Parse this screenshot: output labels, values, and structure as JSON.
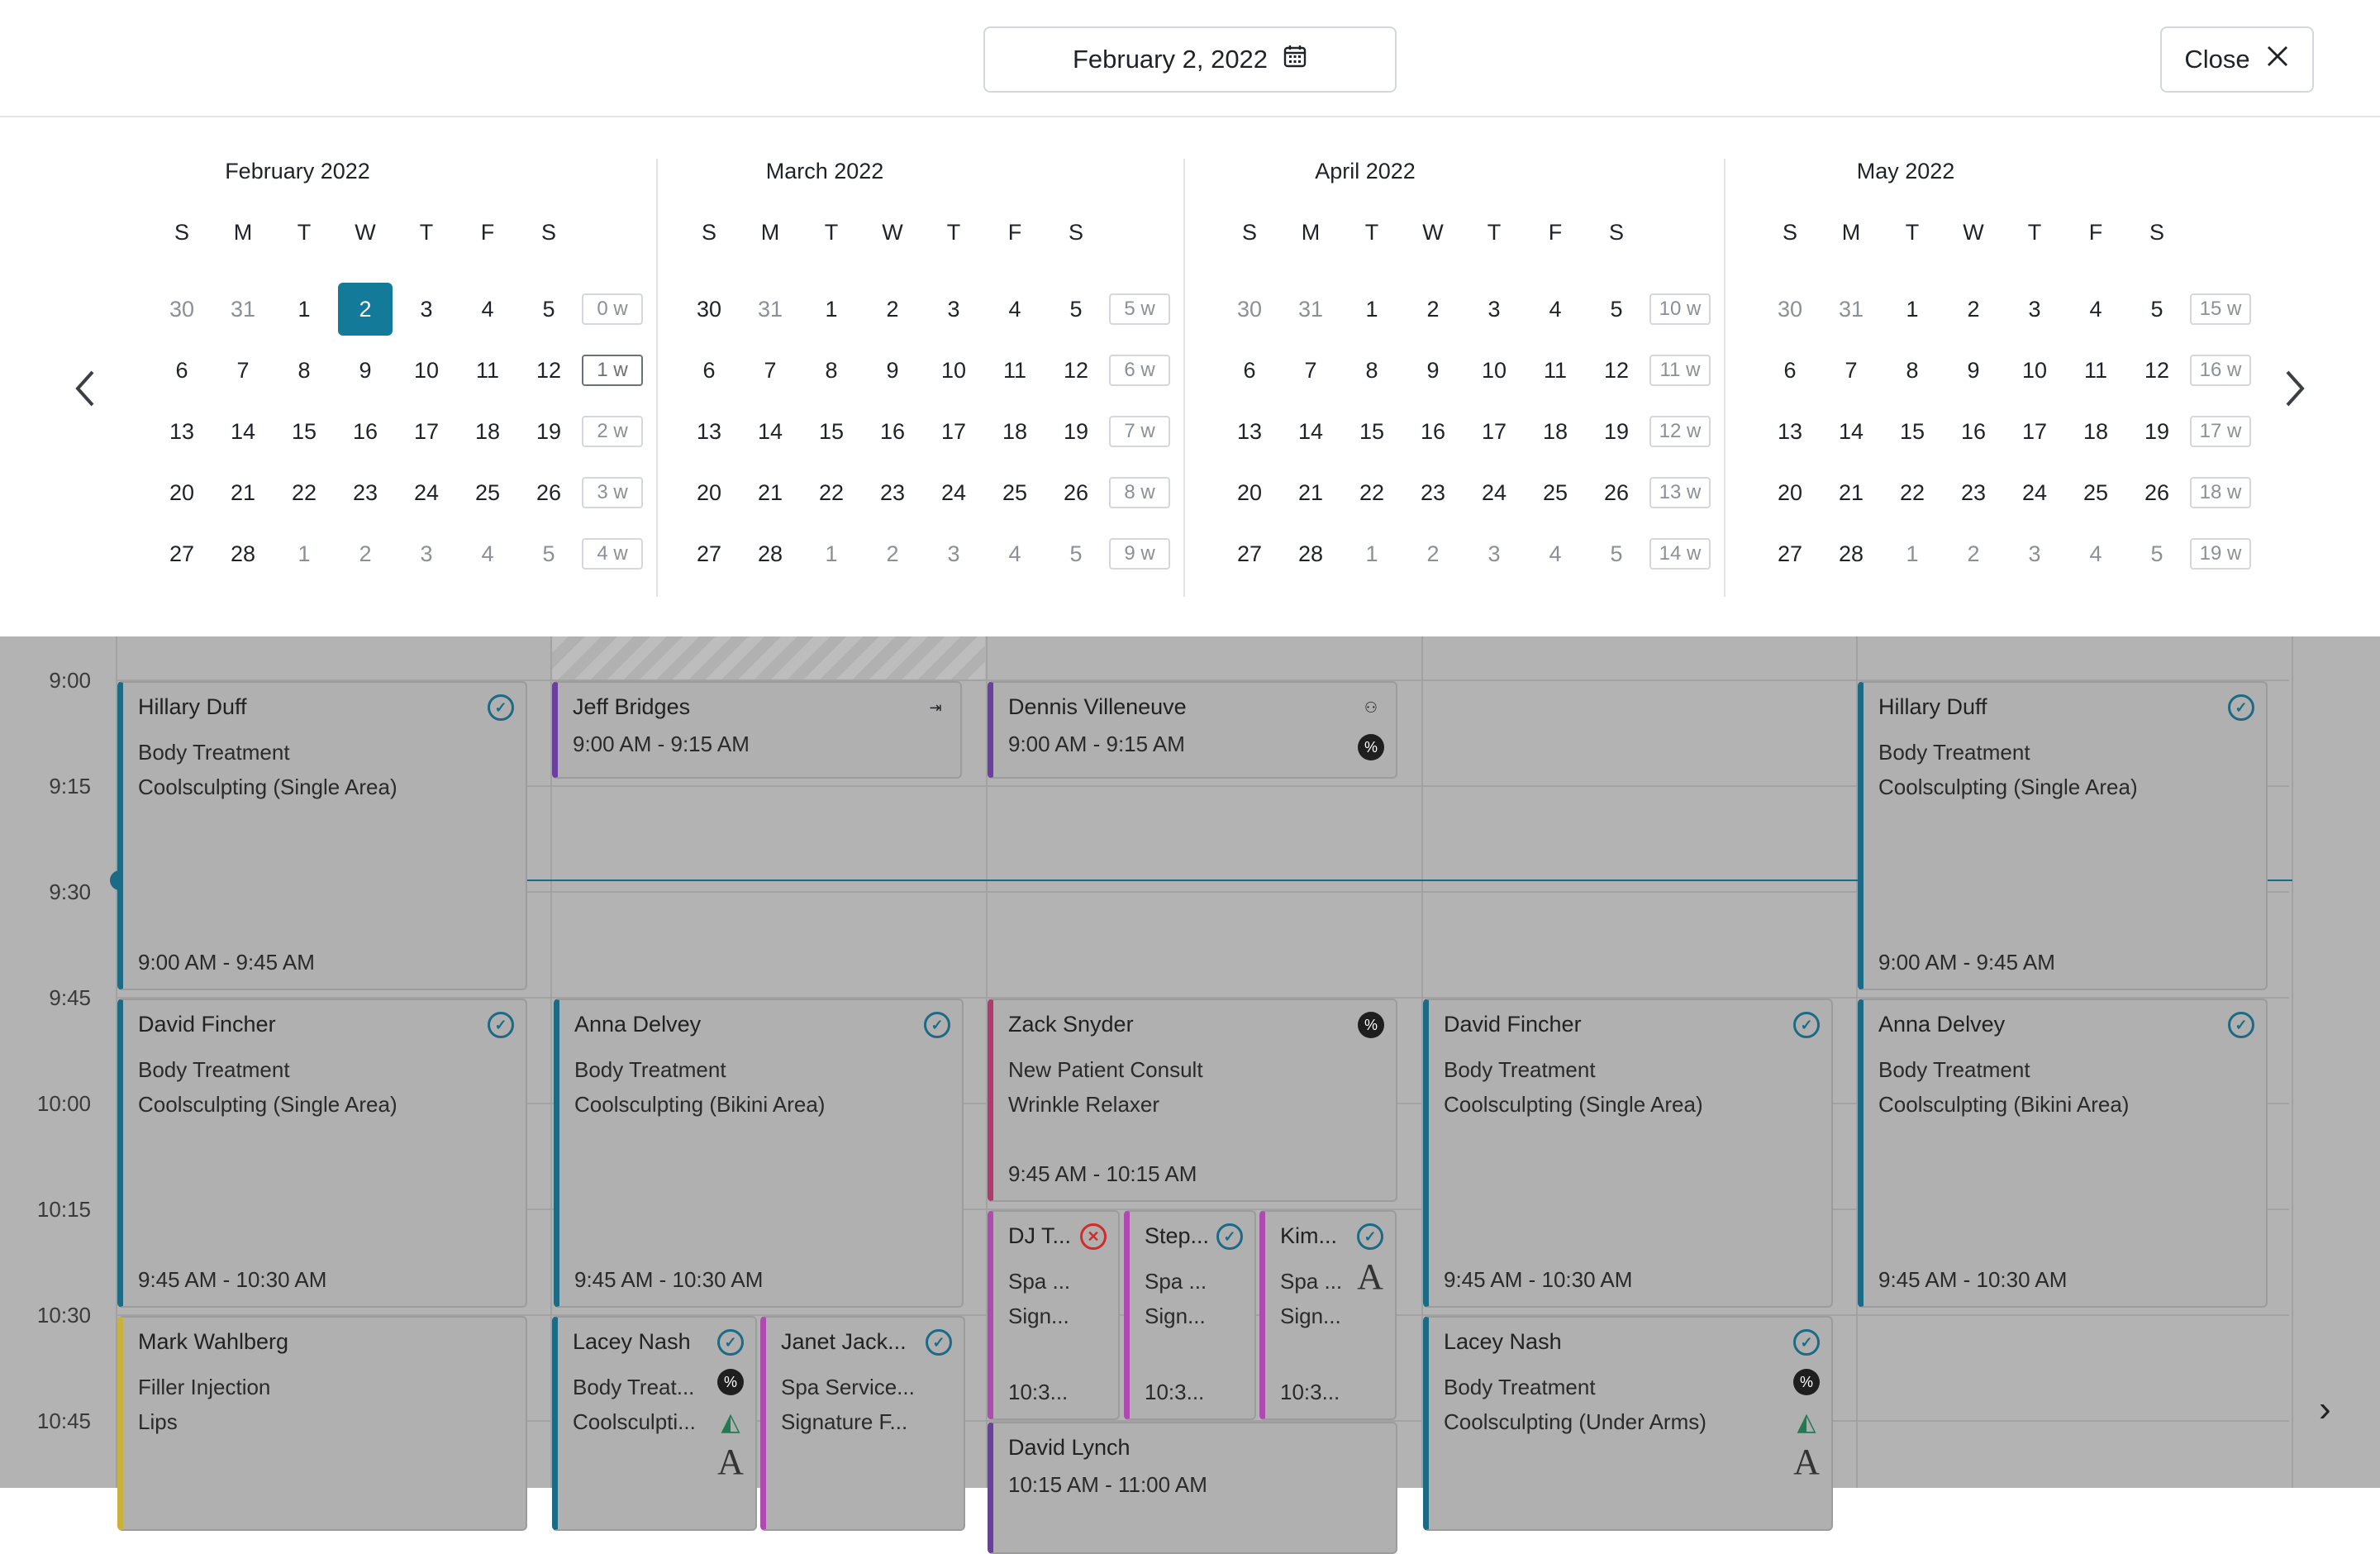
{
  "header": {
    "date_label": "February 2, 2022",
    "close_label": "Close"
  },
  "calendar": {
    "weekday_headers": [
      "S",
      "M",
      "T",
      "W",
      "T",
      "F",
      "S"
    ],
    "selected_day": "2",
    "current_week_label": "1 w",
    "months": [
      {
        "title": "February 2022",
        "weeks": [
          {
            "label": "0 w",
            "days": [
              [
                "30",
                1
              ],
              [
                "31",
                1
              ],
              [
                "1",
                0
              ],
              [
                "2",
                0
              ],
              [
                "3",
                0
              ],
              [
                "4",
                0
              ],
              [
                "5",
                0
              ]
            ]
          },
          {
            "label": "1 w",
            "days": [
              [
                "6",
                0
              ],
              [
                "7",
                0
              ],
              [
                "8",
                0
              ],
              [
                "9",
                0
              ],
              [
                "10",
                0
              ],
              [
                "11",
                0
              ],
              [
                "12",
                0
              ]
            ]
          },
          {
            "label": "2 w",
            "days": [
              [
                "13",
                0
              ],
              [
                "14",
                0
              ],
              [
                "15",
                0
              ],
              [
                "16",
                0
              ],
              [
                "17",
                0
              ],
              [
                "18",
                0
              ],
              [
                "19",
                0
              ]
            ]
          },
          {
            "label": "3 w",
            "days": [
              [
                "20",
                0
              ],
              [
                "21",
                0
              ],
              [
                "22",
                0
              ],
              [
                "23",
                0
              ],
              [
                "24",
                0
              ],
              [
                "25",
                0
              ],
              [
                "26",
                0
              ]
            ]
          },
          {
            "label": "4 w",
            "days": [
              [
                "27",
                0
              ],
              [
                "28",
                0
              ],
              [
                "1",
                1
              ],
              [
                "2",
                1
              ],
              [
                "3",
                1
              ],
              [
                "4",
                1
              ],
              [
                "5",
                1
              ]
            ]
          }
        ]
      },
      {
        "title": "March 2022",
        "weeks": [
          {
            "label": "5 w",
            "days": [
              [
                "30",
                0
              ],
              [
                "31",
                1
              ],
              [
                "1",
                0
              ],
              [
                "2",
                0
              ],
              [
                "3",
                0
              ],
              [
                "4",
                0
              ],
              [
                "5",
                0
              ]
            ]
          },
          {
            "label": "6 w",
            "days": [
              [
                "6",
                0
              ],
              [
                "7",
                0
              ],
              [
                "8",
                0
              ],
              [
                "9",
                0
              ],
              [
                "10",
                0
              ],
              [
                "11",
                0
              ],
              [
                "12",
                0
              ]
            ]
          },
          {
            "label": "7 w",
            "days": [
              [
                "13",
                0
              ],
              [
                "14",
                0
              ],
              [
                "15",
                0
              ],
              [
                "16",
                0
              ],
              [
                "17",
                0
              ],
              [
                "18",
                0
              ],
              [
                "19",
                0
              ]
            ]
          },
          {
            "label": "8 w",
            "days": [
              [
                "20",
                0
              ],
              [
                "21",
                0
              ],
              [
                "22",
                0
              ],
              [
                "23",
                0
              ],
              [
                "24",
                0
              ],
              [
                "25",
                0
              ],
              [
                "26",
                0
              ]
            ]
          },
          {
            "label": "9 w",
            "days": [
              [
                "27",
                0
              ],
              [
                "28",
                0
              ],
              [
                "1",
                1
              ],
              [
                "2",
                1
              ],
              [
                "3",
                1
              ],
              [
                "4",
                1
              ],
              [
                "5",
                1
              ]
            ]
          }
        ]
      },
      {
        "title": "April 2022",
        "weeks": [
          {
            "label": "10 w",
            "days": [
              [
                "30",
                1
              ],
              [
                "31",
                1
              ],
              [
                "1",
                0
              ],
              [
                "2",
                0
              ],
              [
                "3",
                0
              ],
              [
                "4",
                0
              ],
              [
                "5",
                0
              ]
            ]
          },
          {
            "label": "11 w",
            "days": [
              [
                "6",
                0
              ],
              [
                "7",
                0
              ],
              [
                "8",
                0
              ],
              [
                "9",
                0
              ],
              [
                "10",
                0
              ],
              [
                "11",
                0
              ],
              [
                "12",
                0
              ]
            ]
          },
          {
            "label": "12 w",
            "days": [
              [
                "13",
                0
              ],
              [
                "14",
                0
              ],
              [
                "15",
                0
              ],
              [
                "16",
                0
              ],
              [
                "17",
                0
              ],
              [
                "18",
                0
              ],
              [
                "19",
                0
              ]
            ]
          },
          {
            "label": "13 w",
            "days": [
              [
                "20",
                0
              ],
              [
                "21",
                0
              ],
              [
                "22",
                0
              ],
              [
                "23",
                0
              ],
              [
                "24",
                0
              ],
              [
                "25",
                0
              ],
              [
                "26",
                0
              ]
            ]
          },
          {
            "label": "14 w",
            "days": [
              [
                "27",
                0
              ],
              [
                "28",
                0
              ],
              [
                "1",
                1
              ],
              [
                "2",
                1
              ],
              [
                "3",
                1
              ],
              [
                "4",
                1
              ],
              [
                "5",
                1
              ]
            ]
          }
        ]
      },
      {
        "title": "May 2022",
        "weeks": [
          {
            "label": "15 w",
            "days": [
              [
                "30",
                1
              ],
              [
                "31",
                1
              ],
              [
                "1",
                0
              ],
              [
                "2",
                0
              ],
              [
                "3",
                0
              ],
              [
                "4",
                0
              ],
              [
                "5",
                0
              ]
            ]
          },
          {
            "label": "16 w",
            "days": [
              [
                "6",
                0
              ],
              [
                "7",
                0
              ],
              [
                "8",
                0
              ],
              [
                "9",
                0
              ],
              [
                "10",
                0
              ],
              [
                "11",
                0
              ],
              [
                "12",
                0
              ]
            ]
          },
          {
            "label": "17 w",
            "days": [
              [
                "13",
                0
              ],
              [
                "14",
                0
              ],
              [
                "15",
                0
              ],
              [
                "16",
                0
              ],
              [
                "17",
                0
              ],
              [
                "18",
                0
              ],
              [
                "19",
                0
              ]
            ]
          },
          {
            "label": "18 w",
            "days": [
              [
                "20",
                0
              ],
              [
                "21",
                0
              ],
              [
                "22",
                0
              ],
              [
                "23",
                0
              ],
              [
                "24",
                0
              ],
              [
                "25",
                0
              ],
              [
                "26",
                0
              ]
            ]
          },
          {
            "label": "19 w",
            "days": [
              [
                "27",
                0
              ],
              [
                "28",
                0
              ],
              [
                "1",
                1
              ],
              [
                "2",
                1
              ],
              [
                "3",
                1
              ],
              [
                "4",
                1
              ],
              [
                "5",
                1
              ]
            ]
          }
        ]
      }
    ]
  },
  "schedule": {
    "time_labels": [
      "9:00",
      "9:15",
      "9:30",
      "9:45",
      "10:00",
      "10:15",
      "10:30",
      "10:45"
    ],
    "appointments": [
      {
        "name": "Hillary Duff",
        "lines": [
          "Body Treatment",
          "Coolsculpting (Single Area)"
        ],
        "time": "9:00 AM - 9:45 AM",
        "icons": [
          "check"
        ],
        "color": "#1b6b86"
      },
      {
        "name": "Jeff Bridges",
        "lines": [],
        "time": "9:00 AM - 9:15 AM",
        "icons": [
          "logout"
        ],
        "color": "#6b3fa0"
      },
      {
        "name": "Dennis Villeneuve",
        "lines": [],
        "time": "9:00 AM - 9:15 AM",
        "icons": [
          "user-x",
          "percent"
        ],
        "color": "#6b3fa0"
      },
      {
        "name": "Hillary Duff",
        "lines": [
          "Body Treatment",
          "Coolsculpting (Single Area)"
        ],
        "time": "9:00 AM - 9:45 AM",
        "icons": [
          "check"
        ],
        "color": "#1b6b86"
      },
      {
        "name": "David Fincher",
        "lines": [
          "Body Treatment",
          "Coolsculpting (Single Area)"
        ],
        "time": "9:45 AM - 10:30 AM",
        "icons": [
          "check"
        ],
        "color": "#1b6b86"
      },
      {
        "name": "Anna Delvey",
        "lines": [
          "Body Treatment",
          "Coolsculpting (Bikini Area)"
        ],
        "time": "9:45 AM - 10:30 AM",
        "icons": [
          "check"
        ],
        "color": "#1b6b86"
      },
      {
        "name": "Zack Snyder",
        "lines": [
          "New Patient Consult",
          "Wrinkle Relaxer"
        ],
        "time": "9:45 AM - 10:15 AM",
        "icons": [
          "percent"
        ],
        "color": "#b03a6a"
      },
      {
        "name": "David Fincher",
        "lines": [
          "Body Treatment",
          "Coolsculpting (Single Area)"
        ],
        "time": "9:45 AM - 10:30 AM",
        "icons": [
          "check"
        ],
        "color": "#1b6b86"
      },
      {
        "name": "Anna Delvey",
        "lines": [
          "Body Treatment",
          "Coolsculpting (Bikini Area)"
        ],
        "time": "9:45 AM - 10:30 AM",
        "icons": [
          "check"
        ],
        "color": "#1b6b86"
      },
      {
        "name": "DJ T...",
        "lines": [
          "Spa ...",
          "Sign..."
        ],
        "time": "10:3...",
        "icons": [
          "cancel"
        ],
        "color": "#b049b0"
      },
      {
        "name": "Step...",
        "lines": [
          "Spa ...",
          "Sign..."
        ],
        "time": "10:3...",
        "icons": [
          "check"
        ],
        "color": "#b049b0"
      },
      {
        "name": "Kim...",
        "lines": [
          "Spa ...",
          "Sign..."
        ],
        "time": "10:3...",
        "icons": [
          "check",
          "A"
        ],
        "color": "#b049b0"
      },
      {
        "name": "Mark Wahlberg",
        "lines": [
          "Filler Injection",
          "Lips"
        ],
        "time": "",
        "icons": [],
        "color": "#c9b23a"
      },
      {
        "name": "Lacey Nash",
        "lines": [
          "Body Treat...",
          "Coolsculpti..."
        ],
        "time": "",
        "icons": [
          "check",
          "percent",
          "leaf",
          "A"
        ],
        "color": "#1b6b86"
      },
      {
        "name": "Janet Jack...",
        "lines": [
          "Spa Service...",
          "Signature F..."
        ],
        "time": "",
        "icons": [
          "check"
        ],
        "color": "#b049b0"
      },
      {
        "name": "David Lynch",
        "lines": [],
        "time": "10:15 AM - 11:00 AM",
        "icons": [],
        "color": "#6b3fa0"
      },
      {
        "name": "Lacey Nash",
        "lines": [
          "Body Treatment",
          "Coolsculpting (Under Arms)"
        ],
        "time": "",
        "icons": [
          "check",
          "percent",
          "leaf",
          "A"
        ],
        "color": "#1b6b86"
      }
    ]
  }
}
